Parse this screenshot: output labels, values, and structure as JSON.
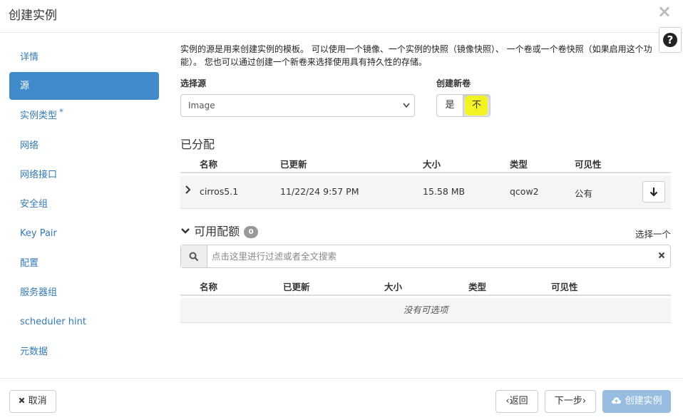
{
  "modal": {
    "title": "创建实例",
    "close_symbol": "×",
    "help_symbol": "?"
  },
  "sidebar": {
    "items": [
      {
        "label": "详情"
      },
      {
        "label": "源"
      },
      {
        "label": "实例类型",
        "required": "*"
      },
      {
        "label": "网络"
      },
      {
        "label": "网络接口"
      },
      {
        "label": "安全组"
      },
      {
        "label": "Key Pair"
      },
      {
        "label": "配置"
      },
      {
        "label": "服务器组"
      },
      {
        "label": "scheduler hint"
      },
      {
        "label": "元数据"
      }
    ],
    "active_index": 1
  },
  "main": {
    "intro": "实例的源是用来创建实例的模板。 可以使用一个镜像、一个实例的快照（镜像快照）、 一个卷或一个卷快照（如果启用这个功能）。 您也可以通过创建一个新卷来选择使用具有持久性的存储。",
    "source_label": "选择源",
    "source_value": "Image",
    "new_volume_label": "创建新卷",
    "new_volume_yes": "是",
    "new_volume_no": "不",
    "new_volume_selected": "不",
    "highlight_color": "#f4f40e"
  },
  "allocated": {
    "title": "已分配",
    "columns": [
      "名称",
      "已更新",
      "大小",
      "类型",
      "可见性"
    ],
    "rows": [
      {
        "name": "cirros5.1",
        "updated": "11/22/24 9:57 PM",
        "size": "15.58 MB",
        "type": "qcow2",
        "visibility": "公有"
      }
    ]
  },
  "available": {
    "title": "可用配额",
    "count": "0",
    "select_one": "选择一个",
    "search_placeholder": "点击这里进行过滤或者全文搜索",
    "columns": [
      "名称",
      "已更新",
      "大小",
      "类型",
      "可见性"
    ],
    "empty_text": "没有可选项"
  },
  "footer": {
    "cancel": "取消",
    "back": "‹返回",
    "next": "下一步›",
    "create": "创建实例",
    "primary_color": "#97bde0"
  }
}
